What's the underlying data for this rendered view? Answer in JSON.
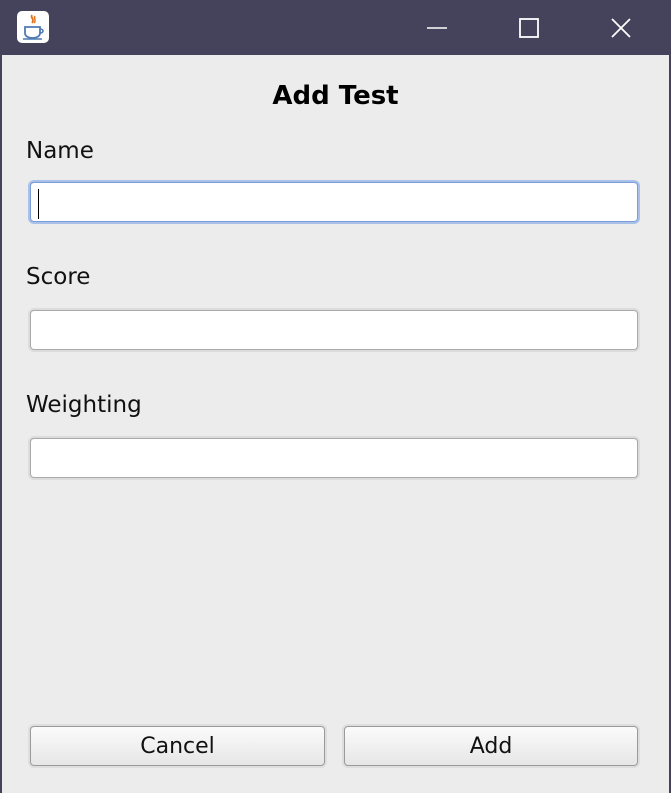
{
  "window": {
    "controls": [
      "minimize-icon",
      "maximize-icon",
      "close-icon"
    ],
    "app_icon": "java-coffee-cup-icon",
    "titlebar_color": "#44435b"
  },
  "dialog": {
    "title": "Add Test",
    "fields": [
      {
        "label": "Name",
        "value": "",
        "focused": true
      },
      {
        "label": "Score",
        "value": ""
      },
      {
        "label": "Weighting",
        "value": ""
      }
    ],
    "buttons": {
      "cancel": "Cancel",
      "add": "Add"
    },
    "focus_color": "#7b9ed6"
  }
}
